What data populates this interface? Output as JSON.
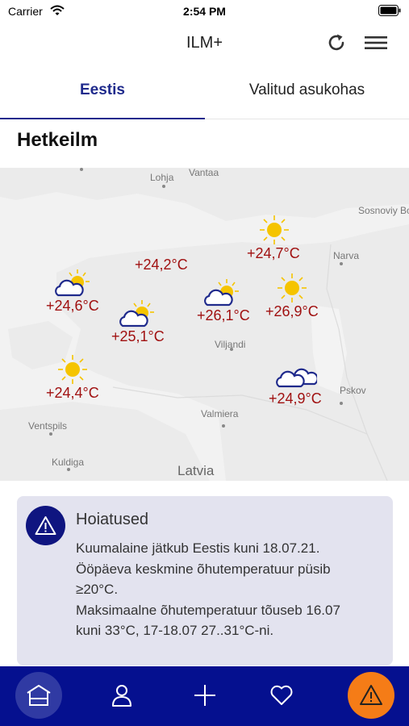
{
  "status_bar": {
    "carrier": "Carrier",
    "time": "2:54 PM"
  },
  "header": {
    "title": "ILM+",
    "refresh_icon": "refresh-icon",
    "menu_icon": "hamburger-menu-icon"
  },
  "tabs": [
    {
      "label": "Eestis",
      "active": true
    },
    {
      "label": "Valitud asukohas",
      "active": false
    }
  ],
  "section_title": "Hetkeilm",
  "map": {
    "places": [
      {
        "name": "Lohja"
      },
      {
        "name": "Vantaa"
      },
      {
        "name": "Sosnoviy Bo"
      },
      {
        "name": "Narva"
      },
      {
        "name": "Viljandi"
      },
      {
        "name": "Pskov"
      },
      {
        "name": "Valmiera"
      },
      {
        "name": "Ventspils"
      },
      {
        "name": "Kuldiga"
      },
      {
        "name": "Latvia"
      }
    ],
    "stations": [
      {
        "temp": "+24,6°C",
        "icon": "partly-cloudy-icon"
      },
      {
        "temp": "+24,2°C",
        "icon": "none"
      },
      {
        "temp": "+24,7°C",
        "icon": "sun-icon"
      },
      {
        "temp": "+25,1°C",
        "icon": "partly-cloudy-icon"
      },
      {
        "temp": "+26,1°C",
        "icon": "partly-cloudy-icon"
      },
      {
        "temp": "+26,9°C",
        "icon": "sun-icon"
      },
      {
        "temp": "+24,4°C",
        "icon": "sun-icon"
      },
      {
        "temp": "+24,9°C",
        "icon": "cloudy-icon"
      }
    ]
  },
  "warning": {
    "title": "Hoiatused",
    "lines": [
      "Kuumalaine jätkub Eestis kuni 18.07.21.",
      "Ööpäeva keskmine õhutemperatuur püsib",
      "≥20°C.",
      "Maksimaalne õhutemperatuur tõuseb 16.07",
      "kuni 33°C, 17-18.07 27..31°C-ni."
    ]
  },
  "bottom_nav": {
    "items": [
      "home-icon",
      "profile-icon",
      "plus-icon",
      "heart-icon",
      "warning-icon"
    ],
    "colors": {
      "bar": "#05108f",
      "active_home": "#303aa3",
      "warning": "#f57c17"
    }
  },
  "colors": {
    "accent": "#1f2a8c",
    "temperature": "#a01010",
    "warn_bg": "#e3e3ef"
  }
}
